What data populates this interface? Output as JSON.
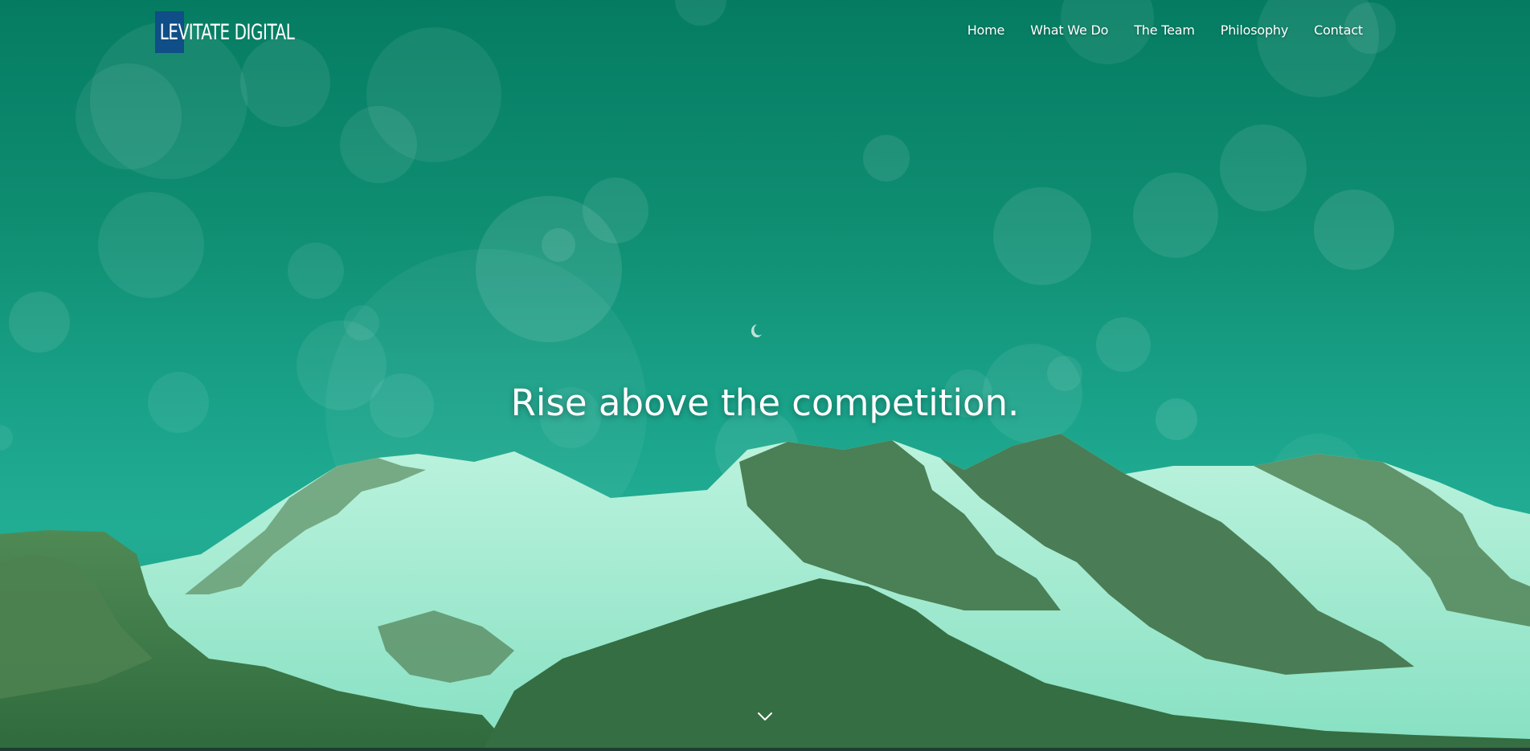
{
  "brand": {
    "logo_text": "LEVITATE DIGITAL",
    "logo_box_color": "#0f4e87"
  },
  "nav": {
    "items": [
      {
        "label": "Home"
      },
      {
        "label": "What We Do"
      },
      {
        "label": "The Team"
      },
      {
        "label": "Philosophy"
      },
      {
        "label": "Contact"
      }
    ]
  },
  "hero": {
    "headline": "Rise above the competition.",
    "overlay_color": "#0f9a7c",
    "scroll_icon": "chevron-down-icon"
  }
}
